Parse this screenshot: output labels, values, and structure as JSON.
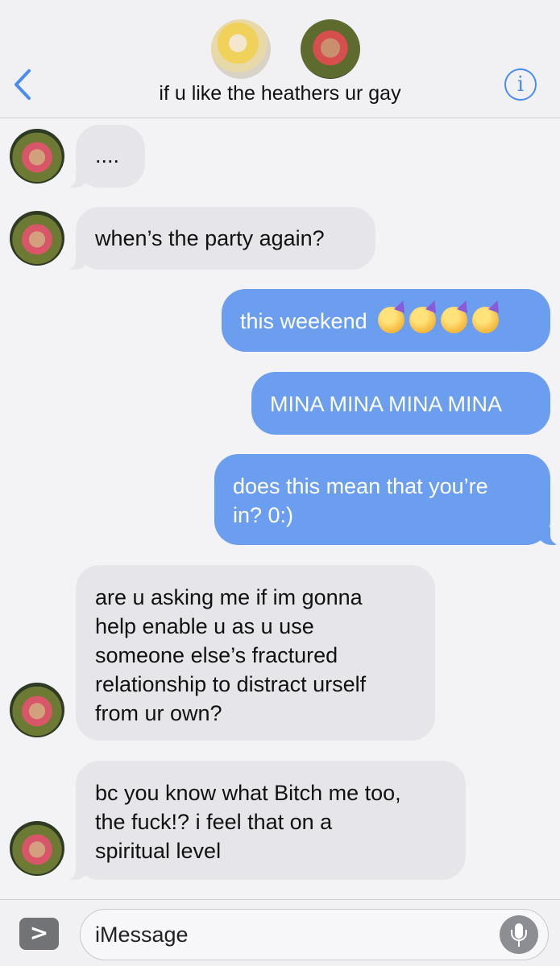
{
  "header": {
    "group_name": "if u like the heathers ur gay",
    "back_icon": "chevron-left-icon",
    "info_icon": "info-icon",
    "info_glyph": "i"
  },
  "messages": [
    {
      "from": "them",
      "text": "...."
    },
    {
      "from": "them",
      "text": "when’s the party again?"
    },
    {
      "from": "me",
      "text": "this weekend",
      "emoji": [
        "party-face-emoji",
        "party-face-emoji",
        "party-face-emoji",
        "party-face-emoji"
      ]
    },
    {
      "from": "me",
      "text": "MINA MINA MINA MINA"
    },
    {
      "from": "me",
      "text": "does this mean that you’re\nin? 0:)"
    },
    {
      "from": "them",
      "text": "are u asking me if im gonna\nhelp enable u as u use\nsomeone else’s fractured\nrelationship to distract urself\nfrom ur own?"
    },
    {
      "from": "them",
      "text": "bc you know what Bitch me too,\nthe fuck!? i feel that on a\nspiritual level"
    }
  ],
  "composer": {
    "placeholder": "iMessage",
    "expand_glyph": ">",
    "mic_icon": "microphone-icon"
  },
  "colors": {
    "accent": "#4a8cf0",
    "outgoing_bubble": "#6c9ef0",
    "incoming_bubble": "#e6e5ea",
    "background": "#f3f2f5"
  }
}
